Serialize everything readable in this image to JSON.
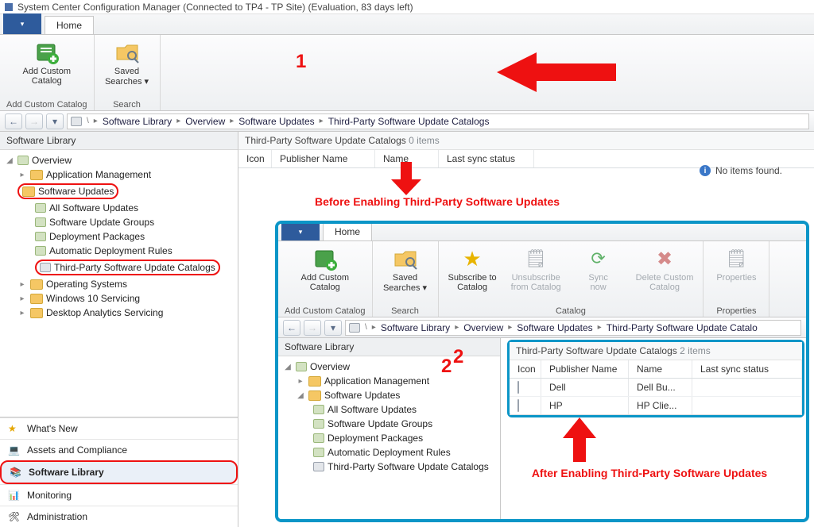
{
  "title": "System Center Configuration Manager (Connected to TP4 - TP Site) (Evaluation, 83 days left)",
  "ribbon": {
    "home_tab": "Home",
    "groups": {
      "addCustomCatalog": {
        "btn": "Add Custom\nCatalog",
        "label": "Add Custom Catalog"
      },
      "search": {
        "btn": "Saved\nSearches ▾",
        "label": "Search"
      }
    }
  },
  "ribbon2": {
    "groups": {
      "addCustomCatalog": {
        "btn": "Add Custom\nCatalog",
        "label": "Add Custom Catalog"
      },
      "search": {
        "btn": "Saved\nSearches ▾",
        "label": "Search"
      },
      "catalog": {
        "sub": "Subscribe to\nCatalog",
        "unsub": "Unsubscribe\nfrom Catalog",
        "sync": "Sync\nnow",
        "del": "Delete Custom\nCatalog",
        "label": "Catalog"
      },
      "props": {
        "btn": "Properties",
        "label": "Properties"
      }
    }
  },
  "breadcrumb": {
    "items": [
      "Software Library",
      "Overview",
      "Software Updates",
      "Third-Party Software Update Catalogs"
    ]
  },
  "breadcrumb2": {
    "items": [
      "Software Library",
      "Overview",
      "Software Updates",
      "Third-Party Software Update Catalo"
    ]
  },
  "tree": {
    "title": "Software Library",
    "nodes": {
      "overview": "Overview",
      "appmgmt": "Application Management",
      "su": "Software Updates",
      "allsu": "All Software Updates",
      "sugroups": "Software Update Groups",
      "deploy": "Deployment Packages",
      "adr": "Automatic Deployment Rules",
      "thirdparty": "Third-Party Software Update Catalogs",
      "os": "Operating Systems",
      "win10": "Windows 10 Servicing",
      "desktop": "Desktop Analytics Servicing"
    }
  },
  "wunderbar": {
    "whatsnew": "What's New",
    "assets": "Assets and Compliance",
    "software": "Software Library",
    "monitoring": "Monitoring",
    "admin": "Administration"
  },
  "list1": {
    "title": "Third-Party Software Update Catalogs",
    "count": "0 items",
    "cols": {
      "icon": "Icon",
      "pub": "Publisher Name",
      "name": "Name",
      "sync": "Last sync status"
    },
    "noitems": "No items found."
  },
  "list2": {
    "title": "Third-Party Software Update Catalogs",
    "count": "2 items",
    "cols": {
      "icon": "Icon",
      "pub": "Publisher Name",
      "name": "Name",
      "sync": "Last sync status"
    },
    "rows": [
      {
        "pub": "Dell",
        "name": "Dell Bu..."
      },
      {
        "pub": "HP",
        "name": "HP Clie..."
      }
    ]
  },
  "annotations": {
    "num1": "1",
    "num2": "2",
    "before": "Before Enabling Third-Party Software Updates",
    "after": "After Enabling Third-Party Software Updates"
  }
}
